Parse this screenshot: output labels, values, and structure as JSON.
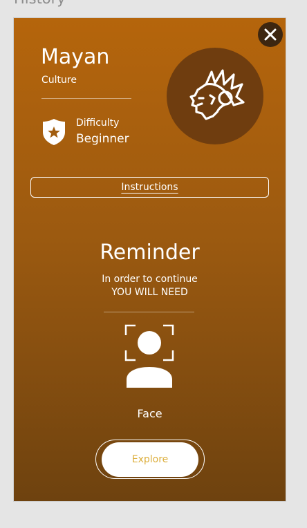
{
  "page": {
    "heading": "History"
  },
  "modal": {
    "title": "Mayan",
    "subtitle": "Culture",
    "difficulty_label": "Difficulty",
    "difficulty_value": "Beginner",
    "emblem_icon": "mayan-headdress-icon",
    "instructions_label": "Instructions",
    "reminder": {
      "title": "Reminder",
      "line1": "In order to continue",
      "line2": "YOU WILL NEED"
    },
    "requirement": {
      "icon": "face-scan-icon",
      "label": "Face"
    },
    "explore_label": "Explore"
  },
  "colors": {
    "gradient_top": "#b5650c",
    "gradient_bottom": "#6e420f",
    "emblem_bg": "#6f3d0f",
    "close_bg": "#3d2610",
    "explore_text": "#dcae3c"
  }
}
